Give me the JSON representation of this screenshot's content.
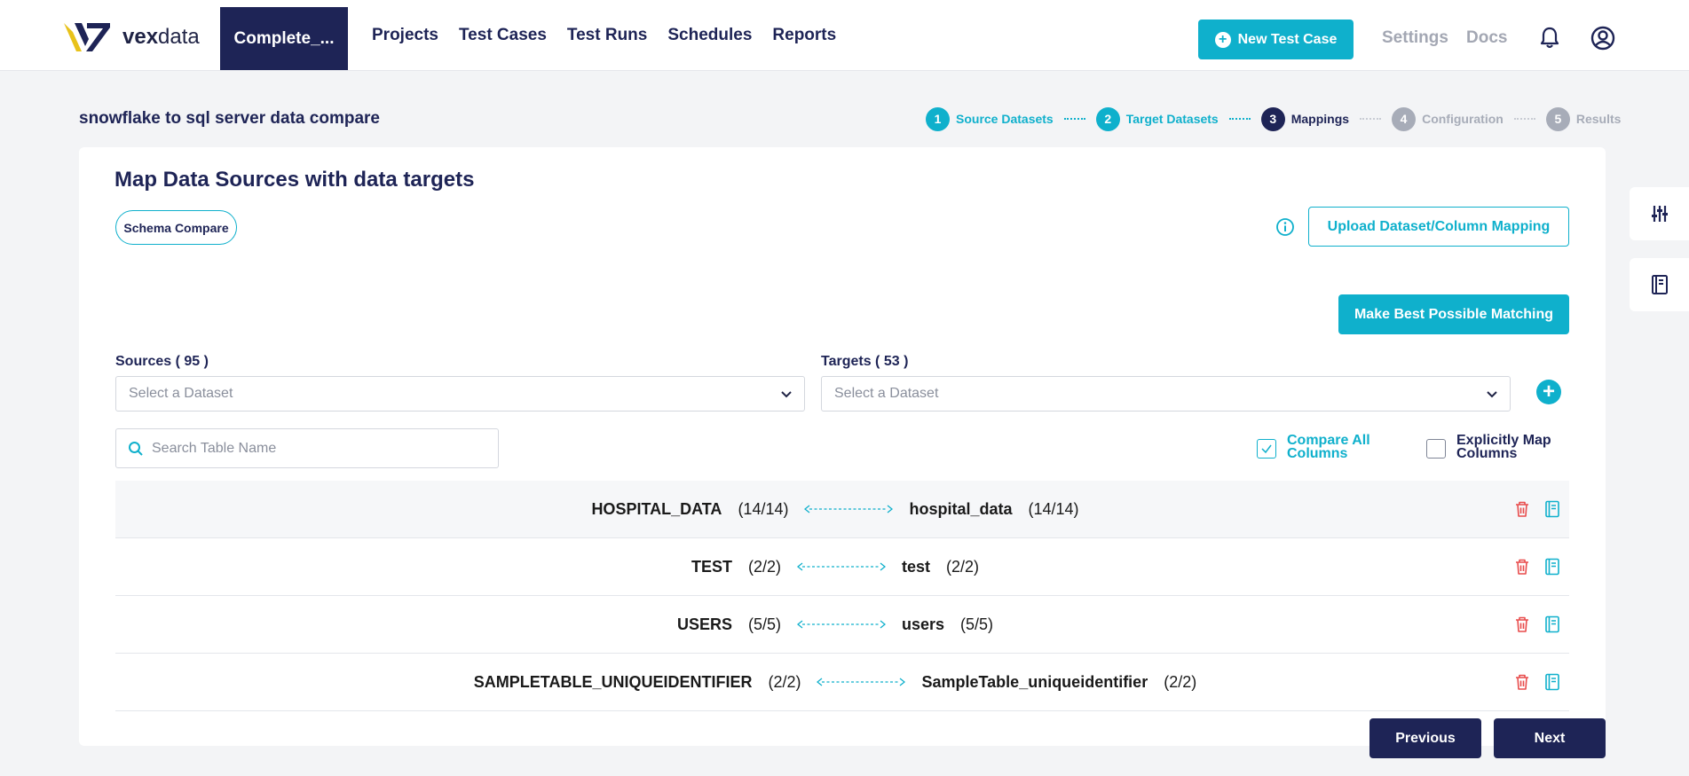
{
  "app": {
    "brand": "vexdata",
    "brand_bold": "vex",
    "brand_light": "data"
  },
  "topnav": {
    "project_tab": "Complete_...",
    "links": [
      "Projects",
      "Test Cases",
      "Test Runs",
      "Schedules",
      "Reports"
    ],
    "new_test_case": "New Test Case",
    "settings": "Settings",
    "docs": "Docs"
  },
  "header": {
    "title": "snowflake to sql server data compare",
    "steps": [
      {
        "num": "1",
        "label": "Source Datasets",
        "state": "done"
      },
      {
        "num": "2",
        "label": "Target Datasets",
        "state": "done"
      },
      {
        "num": "3",
        "label": "Mappings",
        "state": "active"
      },
      {
        "num": "4",
        "label": "Configuration",
        "state": "pending"
      },
      {
        "num": "5",
        "label": "Results",
        "state": "pending"
      }
    ]
  },
  "card": {
    "title": "Map Data Sources with data targets",
    "schema_compare": "Schema Compare",
    "upload_mapping": "Upload Dataset/Column Mapping",
    "best_matching": "Make Best Possible Matching",
    "sources_label": "Sources ( 95 )",
    "targets_label": "Targets ( 53 )",
    "sources_placeholder": "Select a Dataset",
    "targets_placeholder": "Select a Dataset",
    "search_placeholder": "Search Table Name",
    "compare_all": {
      "label": "Compare All Columns",
      "checked": true
    },
    "explicit_map": {
      "label": "Explicitly Map Columns",
      "checked": false
    }
  },
  "mappings": [
    {
      "source": "HOSPITAL_DATA",
      "source_count": "(14/14)",
      "target": "hospital_data",
      "target_count": "(14/14)"
    },
    {
      "source": "TEST",
      "source_count": "(2/2)",
      "target": "test",
      "target_count": "(2/2)"
    },
    {
      "source": "USERS",
      "source_count": "(5/5)",
      "target": "users",
      "target_count": "(5/5)"
    },
    {
      "source": "SAMPLETABLE_UNIQUEIDENTIFIER",
      "source_count": "(2/2)",
      "target": "SampleTable_uniqueidentifier",
      "target_count": "(2/2)"
    }
  ],
  "footer": {
    "previous": "Previous",
    "next": "Next"
  },
  "colors": {
    "accent": "#0fb0cc",
    "navy": "#1e2456",
    "danger": "#e84c4c",
    "muted": "#a7acb8"
  },
  "icons": [
    "plus-circle-icon",
    "bell-icon",
    "user-circle-icon",
    "info-icon",
    "chevron-down-icon",
    "search-icon",
    "trash-icon",
    "notebook-icon",
    "sliders-icon"
  ]
}
